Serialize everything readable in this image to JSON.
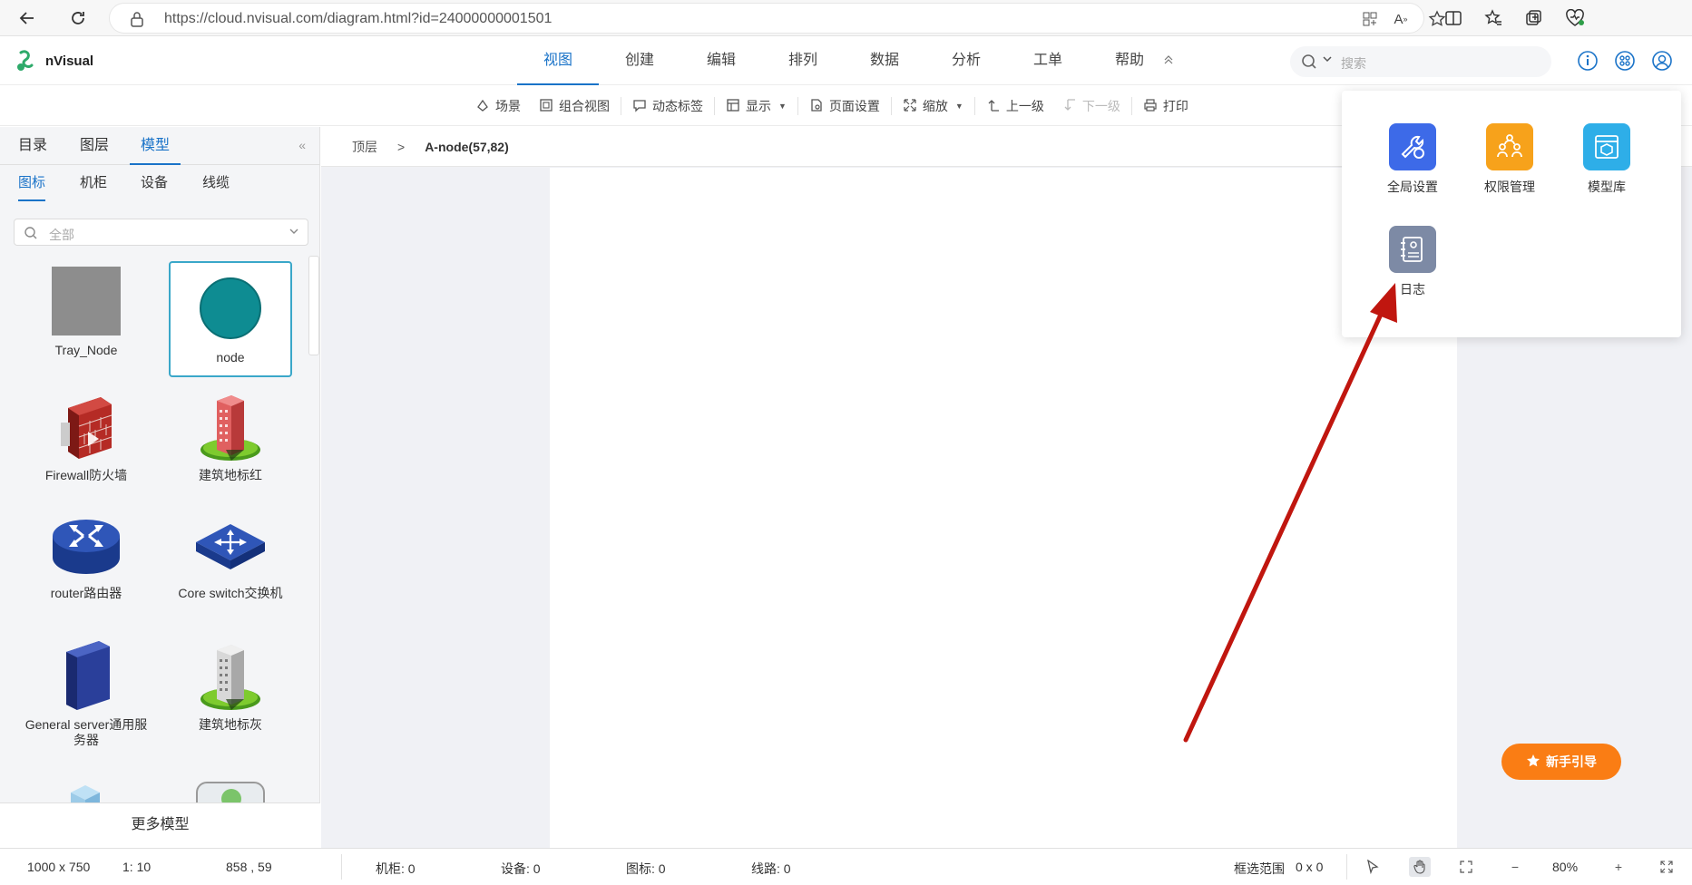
{
  "browser": {
    "url": "https://cloud.nvisual.com/diagram.html?id=24000000001501"
  },
  "app": {
    "name": "nVisual",
    "menu": [
      "视图",
      "创建",
      "编辑",
      "排列",
      "数据",
      "分析",
      "工单",
      "帮助"
    ],
    "active_menu": 0,
    "search_placeholder": "搜索"
  },
  "toolbar": {
    "items": [
      {
        "label": "场景",
        "icon": "scene-icon"
      },
      {
        "label": "组合视图",
        "icon": "combined-view-icon"
      },
      {
        "label": "动态标签",
        "icon": "dynamic-label-icon"
      },
      {
        "label": "显示",
        "icon": "display-icon",
        "dropdown": true
      },
      {
        "label": "页面设置",
        "icon": "page-settings-icon"
      },
      {
        "label": "缩放",
        "icon": "zoom-icon",
        "dropdown": true
      },
      {
        "label": "上一级",
        "icon": "level-up-icon"
      },
      {
        "label": "下一级",
        "icon": "level-down-icon",
        "disabled": true
      },
      {
        "label": "打印",
        "icon": "print-icon"
      }
    ]
  },
  "left_panel": {
    "tabs": [
      "目录",
      "图层",
      "模型"
    ],
    "active_tab": 2,
    "subtabs": [
      "图标",
      "机柜",
      "设备",
      "线缆"
    ],
    "active_subtab": 0,
    "filter_placeholder": "全部",
    "models": [
      {
        "label": "Tray_Node"
      },
      {
        "label": "node"
      },
      {
        "label": "Firewall防火墙"
      },
      {
        "label": "建筑地标红"
      },
      {
        "label": "router路由器"
      },
      {
        "label": "Core switch交换机"
      },
      {
        "label": "General server通用服务器"
      },
      {
        "label": "建筑地标灰"
      }
    ],
    "more_label": "更多模型"
  },
  "breadcrumb": {
    "root": "顶层",
    "separator": ">",
    "current": "A-node(57,82)"
  },
  "apps_popup": {
    "items": [
      {
        "label": "全局设置",
        "color": "#3d6ae8",
        "icon": "global-settings-icon"
      },
      {
        "label": "权限管理",
        "color": "#f7a21b",
        "icon": "permission-icon"
      },
      {
        "label": "模型库",
        "color": "#2eaee8",
        "icon": "model-library-icon"
      },
      {
        "label": "日志",
        "color": "#7d8aa5",
        "icon": "log-icon"
      }
    ]
  },
  "guide_button": {
    "label": "新手引导"
  },
  "status_bar": {
    "page_size": "1000 x 750",
    "scale": "1: 10",
    "coords": "858 , 59",
    "cabinet": "机柜: 0",
    "device": "设备: 0",
    "icon_count": "图标: 0",
    "lines": "线路: 0",
    "selection": "框选范围",
    "selection_value": "0 x 0",
    "zoom": "80%"
  },
  "colors": {
    "accent": "#1a73c8",
    "arrow": "#c0160f",
    "guide": "#fa7d14"
  }
}
